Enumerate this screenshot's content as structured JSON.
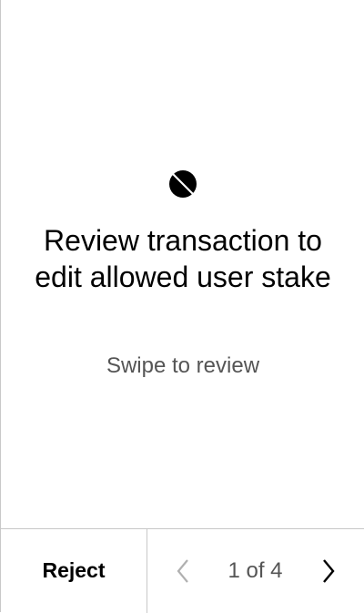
{
  "review": {
    "title": "Review transaction to edit allowed user stake",
    "subtitle": "Swipe to review",
    "app_icon": "ontology-logo-icon"
  },
  "footer": {
    "reject_label": "Reject",
    "page_indicator": "1 of 4",
    "prev_icon": "chevron-left-icon",
    "next_icon": "chevron-right-icon"
  },
  "colors": {
    "text_primary": "#000000",
    "text_secondary": "#555555",
    "divider": "#c8c8c8",
    "disabled_icon": "#b0b0b0"
  }
}
